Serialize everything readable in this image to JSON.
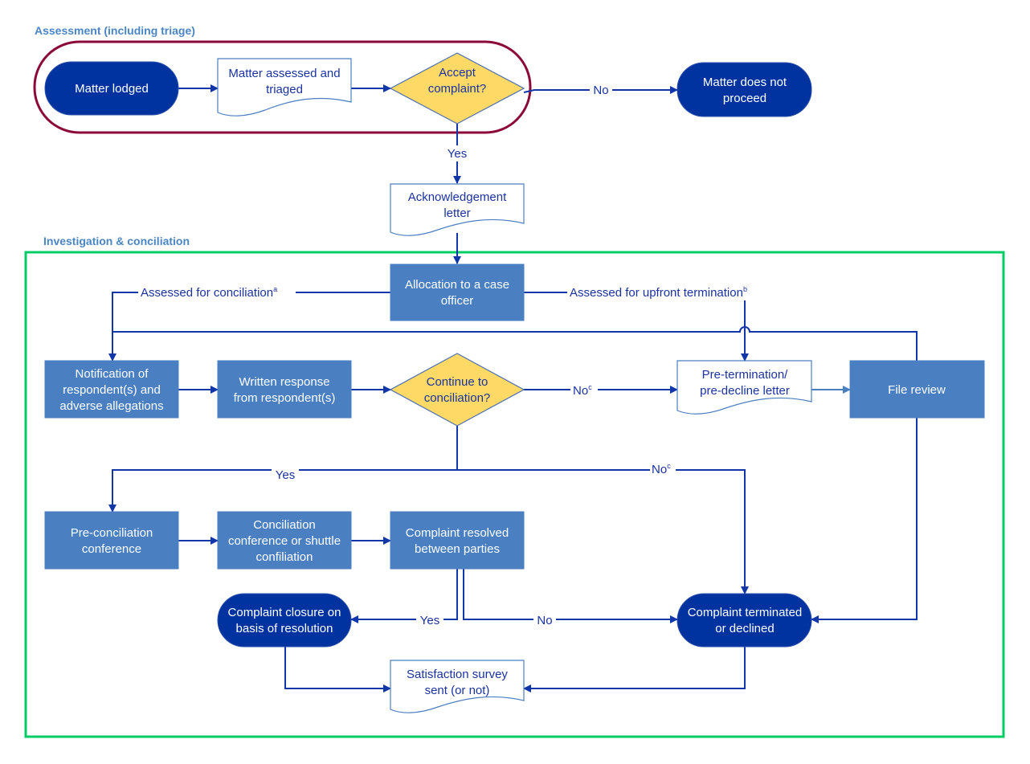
{
  "sections": {
    "assessment": "Assessment (including triage)",
    "investigation": "Investigation & conciliation"
  },
  "nodes": {
    "matter_lodged": [
      "Matter lodged"
    ],
    "matter_assessed": [
      "Matter assessed and",
      "triaged"
    ],
    "accept_complaint": [
      "Accept",
      "complaint?"
    ],
    "matter_not_proceed": [
      "Matter does not",
      "proceed"
    ],
    "ack_letter": [
      "Acknowledgement",
      "letter"
    ],
    "allocation": [
      "Allocation to a case",
      "officer"
    ],
    "notification": [
      "Notification of",
      "respondent(s) and",
      "adverse allegations"
    ],
    "written_response": [
      "Written response",
      "from respondent(s)"
    ],
    "continue_conciliation": [
      "Continue to",
      "conciliation?"
    ],
    "pre_termination": [
      "Pre-termination/",
      "pre-decline letter"
    ],
    "file_review": [
      "File review"
    ],
    "pre_conciliation": [
      "Pre-conciliation",
      "conference"
    ],
    "conciliation_conference": [
      "Conciliation",
      "conference or shuttle",
      "confiliation"
    ],
    "complaint_resolved": [
      "Complaint resolved",
      "between parties"
    ],
    "complaint_closure": [
      "Complaint closure on",
      "basis of resolution"
    ],
    "complaint_terminated": [
      "Complaint terminated",
      "or declined"
    ],
    "satisfaction_survey": [
      "Satisfaction survey",
      "sent (or not)"
    ]
  },
  "edge_labels": {
    "no_accept": "No",
    "yes_accept": "Yes",
    "assessed_conciliation": "Assessed for conciliation",
    "assessed_conciliation_sup": "a",
    "assessed_termination": "Assessed for upfront termination",
    "assessed_termination_sup": "b",
    "no_continue": "No",
    "no_continue_sup": "c",
    "yes_continue": "Yes",
    "no_continue2": "No",
    "no_continue2_sup": "c",
    "yes_resolved": "Yes",
    "no_resolved": "No"
  },
  "colors": {
    "terminal": "#0033a0",
    "process": "#4a7fc1",
    "decision": "#ffd966",
    "assessment_outline": "#8b0a3a",
    "investigation_outline": "#00cc66"
  }
}
